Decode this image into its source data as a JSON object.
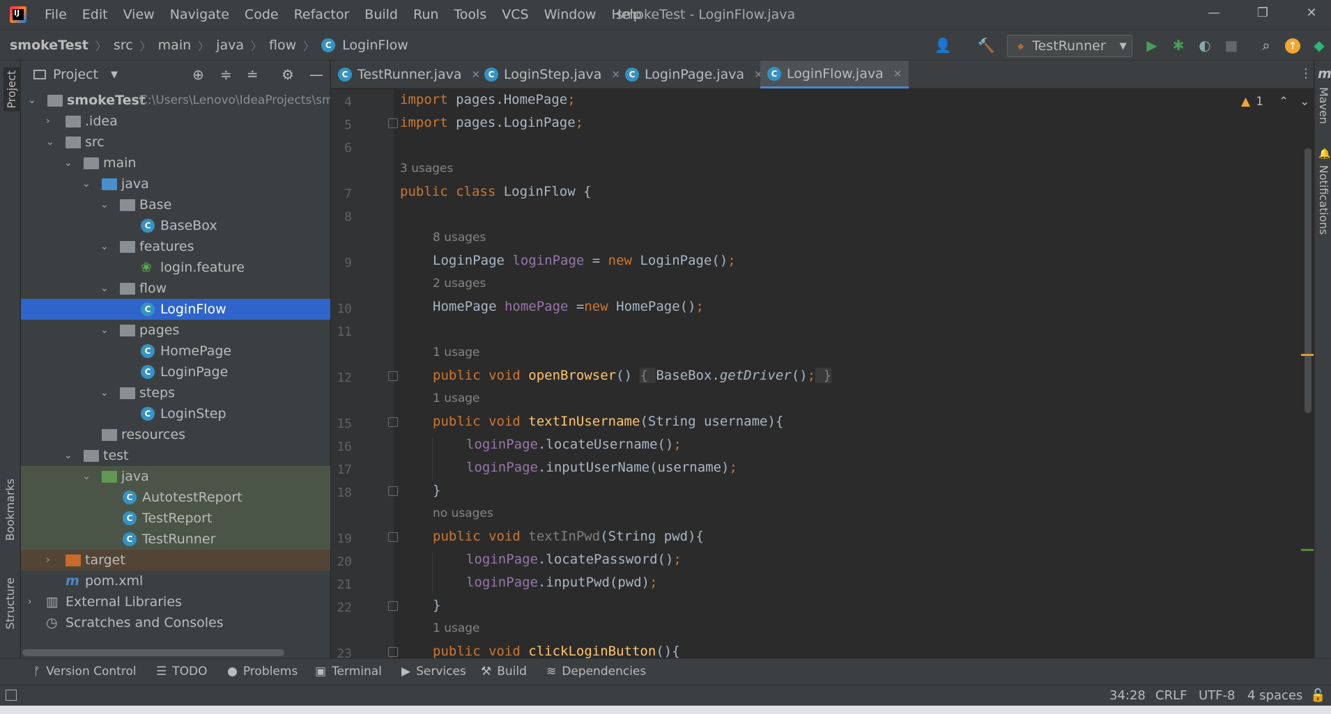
{
  "window": {
    "title": "smokeTest - LoginFlow.java"
  },
  "menu": [
    "File",
    "Edit",
    "View",
    "Navigate",
    "Code",
    "Refactor",
    "Build",
    "Run",
    "Tools",
    "VCS",
    "Window",
    "Help"
  ],
  "breadcrumb": {
    "items": [
      "smokeTest",
      "src",
      "main",
      "java",
      "flow",
      "LoginFlow"
    ]
  },
  "toolbar": {
    "run_config": "TestRunner"
  },
  "sidebar": {
    "left_tabs": [
      "Project",
      "Bookmarks",
      "Structure"
    ],
    "right_tabs": [
      "Maven",
      "Notifications"
    ]
  },
  "project": {
    "header": "Project",
    "root_name": "smokeTest",
    "root_path": "C:\\Users\\Lenovo\\IdeaProjects\\sm",
    "tree": [
      "smokeTest",
      ".idea",
      "src",
      "main",
      "java",
      "Base",
      "BaseBox",
      "features",
      "login.feature",
      "flow",
      "LoginFlow",
      "pages",
      "HomePage",
      "LoginPage",
      "steps",
      "LoginStep",
      "resources",
      "test",
      "java",
      "AutotestReport",
      "TestReport",
      "TestRunner",
      "target",
      "pom.xml",
      "External Libraries",
      "Scratches and Consoles"
    ]
  },
  "tabs": [
    "TestRunner.java",
    "LoginStep.java",
    "LoginPage.java",
    "LoginFlow.java"
  ],
  "editor": {
    "warning_count": "1",
    "line_numbers": [
      "4",
      "5",
      "6",
      "7",
      "8",
      "9",
      "10",
      "11",
      "12",
      "15",
      "16",
      "17",
      "18",
      "19",
      "20",
      "21",
      "22",
      "23"
    ],
    "hints": [
      "3 usages",
      "8 usages",
      "2 usages",
      "1 usage",
      "1 usage",
      "no usages",
      "1 usage"
    ],
    "lines": {
      "l4": [
        "import",
        " pages.HomePage",
        ";"
      ],
      "l5": [
        "import",
        " pages.LoginPage",
        ";"
      ],
      "l7": [
        "public class",
        " LoginFlow {"
      ],
      "l9": [
        "LoginPage ",
        "loginPage",
        " = ",
        "new",
        " LoginPage()",
        ";"
      ],
      "l10": [
        "HomePage ",
        "homePage",
        " =",
        "new",
        " HomePage()",
        ";"
      ],
      "l12": [
        "public void ",
        "openBrowser",
        "() ",
        "{ ",
        "BaseBox.",
        "getDriver",
        "()",
        ";",
        " }"
      ],
      "l15": [
        "public void ",
        "textInUsername",
        "(String username){"
      ],
      "l16": [
        "loginPage",
        ".locateUsername()",
        ";"
      ],
      "l17": [
        "loginPage",
        ".inputUserName(username)",
        ";"
      ],
      "l18": [
        "}"
      ],
      "l19": [
        "public void ",
        "textInPwd",
        "(String pwd){"
      ],
      "l20": [
        "loginPage",
        ".locatePassword()",
        ";"
      ],
      "l21": [
        "loginPage",
        ".inputPwd(pwd)",
        ";"
      ],
      "l22": [
        "}"
      ],
      "l23": [
        "public void ",
        "clickLoginButton",
        "(){"
      ]
    }
  },
  "bottom_tools": [
    "Version Control",
    "TODO",
    "Problems",
    "Terminal",
    "Services",
    "Build",
    "Dependencies"
  ],
  "status": {
    "position": "34:28",
    "line_sep": "CRLF",
    "encoding": "UTF-8",
    "indent": "4 spaces"
  }
}
